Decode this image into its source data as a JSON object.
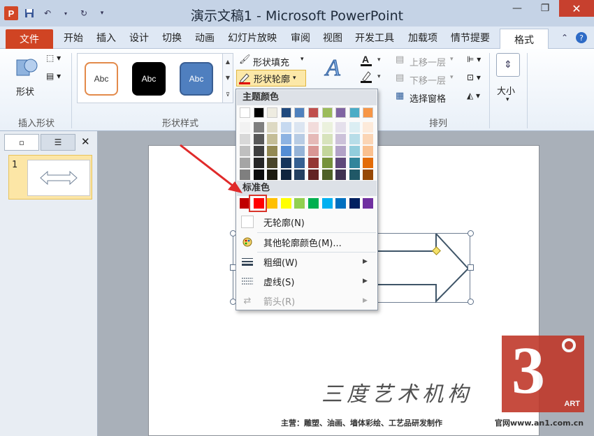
{
  "window": {
    "title": "演示文稿1 - Microsoft PowerPoint",
    "app_icon": "P"
  },
  "tabs": {
    "file": "文件",
    "items": [
      "开始",
      "插入",
      "设计",
      "切换",
      "动画",
      "幻灯片放映",
      "审阅",
      "视图",
      "开发工具",
      "加载项",
      "情节提要"
    ],
    "format": "格式"
  },
  "ribbon": {
    "insert_shape": {
      "shape_label": "形状",
      "group_label": "插入形状"
    },
    "styles": {
      "samples": [
        "Abc",
        "Abc",
        "Abc"
      ],
      "group_label": "形状样式",
      "fill": "形状填充",
      "outline": "形状轮廓"
    },
    "arrange": {
      "bring_forward": "上移一层",
      "send_backward": "下移一层",
      "selection_pane": "选择窗格",
      "group_label": "排列"
    },
    "size": {
      "label": "大小"
    }
  },
  "slides_pane": {
    "slide_number": "1"
  },
  "outline_menu": {
    "theme_colors_label": "主题颜色",
    "theme_top_row": [
      "#ffffff",
      "#000000",
      "#eeece1",
      "#1f497d",
      "#4f81bd",
      "#c0504d",
      "#9bbb59",
      "#8064a2",
      "#4bacc6",
      "#f79646"
    ],
    "theme_shades": [
      [
        "#f2f2f2",
        "#7f7f7f",
        "#ddd9c3",
        "#c6d9f0",
        "#dbe5f1",
        "#f2dcdb",
        "#ebf1dd",
        "#e5e0ec",
        "#dbeef3",
        "#fdeada"
      ],
      [
        "#d8d8d8",
        "#595959",
        "#c4bd97",
        "#8db3e2",
        "#b8cce4",
        "#e5b9b7",
        "#d7e3bc",
        "#ccc1d9",
        "#b7dde8",
        "#fbd5b5"
      ],
      [
        "#bfbfbf",
        "#3f3f3f",
        "#938953",
        "#548dd4",
        "#95b3d7",
        "#d99694",
        "#c3d69b",
        "#b2a2c7",
        "#92cddc",
        "#fac08f"
      ],
      [
        "#a5a5a5",
        "#262626",
        "#494429",
        "#17365d",
        "#366092",
        "#953734",
        "#76923c",
        "#5f497a",
        "#31859b",
        "#e36c09"
      ],
      [
        "#7f7f7f",
        "#0c0c0c",
        "#1d1b10",
        "#0f243e",
        "#244061",
        "#632423",
        "#4f6128",
        "#3f3151",
        "#205867",
        "#974806"
      ]
    ],
    "standard_colors_label": "标准色",
    "standard_colors": [
      "#c00000",
      "#ff0000",
      "#ffc000",
      "#ffff00",
      "#92d050",
      "#00b050",
      "#00b0f0",
      "#0070c0",
      "#002060",
      "#7030a0"
    ],
    "no_outline": "无轮廓(N)",
    "more_colors": "其他轮廓颜色(M)...",
    "weight": "粗细(W)",
    "dashes": "虚线(S)",
    "arrows": "箭头(R)"
  },
  "watermark": {
    "brand": "三度艺术机构",
    "sub": "主营：雕塑、油画、墙体彩绘、工艺品研发制作",
    "url": "官网www.an1.com.cn",
    "logo_text": "3",
    "logo_art": "ART"
  }
}
